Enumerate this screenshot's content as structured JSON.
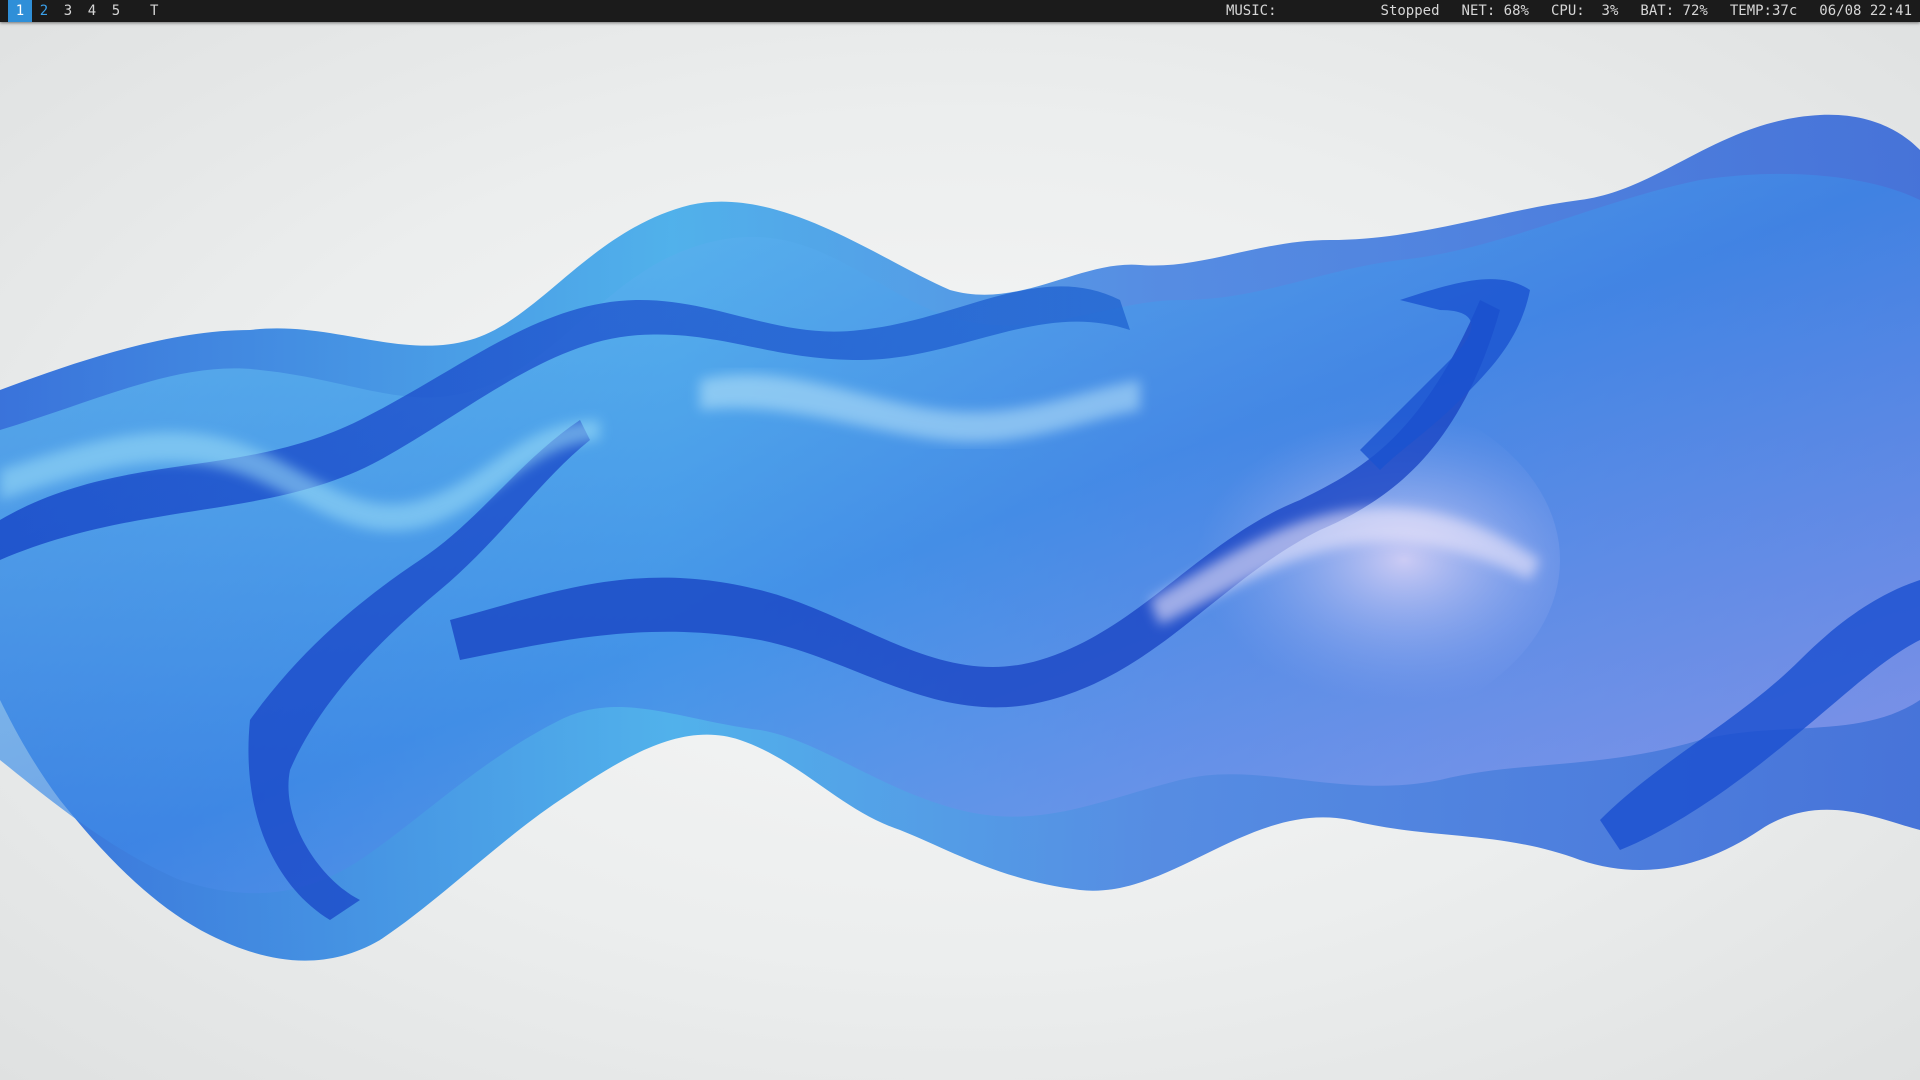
{
  "topbar": {
    "workspaces": [
      {
        "label": "1",
        "state": "active"
      },
      {
        "label": "2",
        "state": "occupied"
      },
      {
        "label": "3",
        "state": "empty"
      },
      {
        "label": "4",
        "state": "empty"
      },
      {
        "label": "5",
        "state": "empty"
      }
    ],
    "layout_symbol": "T",
    "status": {
      "music_label": "MUSIC:",
      "music_state": "Stopped",
      "net": "NET: 68%",
      "cpu": "CPU:  3%",
      "bat": "BAT: 72%",
      "temp": "TEMP:37c",
      "datetime": "06/08 22:41"
    },
    "colors": {
      "bar_bg": "#1b1b1b",
      "text": "#d6d6d6",
      "accent": "#2f8fd8"
    }
  },
  "wallpaper": {
    "icon": "blue-silk-wave-wallpaper"
  }
}
